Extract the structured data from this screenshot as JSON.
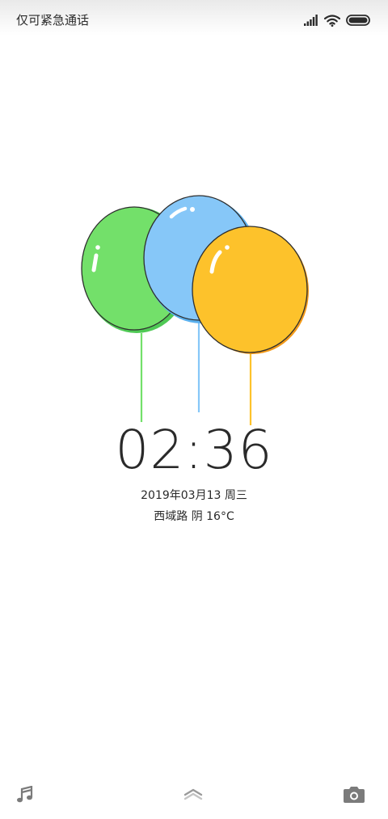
{
  "status_bar": {
    "carrier_text": "仅可紧急通话",
    "signal_icon": "signal-bars-icon",
    "wifi_icon": "wifi-icon",
    "battery_icon": "battery-icon"
  },
  "lockscreen": {
    "time": "02:36",
    "date": "2019年03月13 周三",
    "weather": "西域路 阴 16°C"
  },
  "theme": {
    "balloon_colors": {
      "green": "#73e06a",
      "blue": "#86c7f8",
      "yellow": "#fdc22b"
    }
  },
  "bottom_bar": {
    "left_icon": "music-note-icon",
    "center_icon": "chevron-up-icon",
    "right_icon": "camera-icon"
  }
}
